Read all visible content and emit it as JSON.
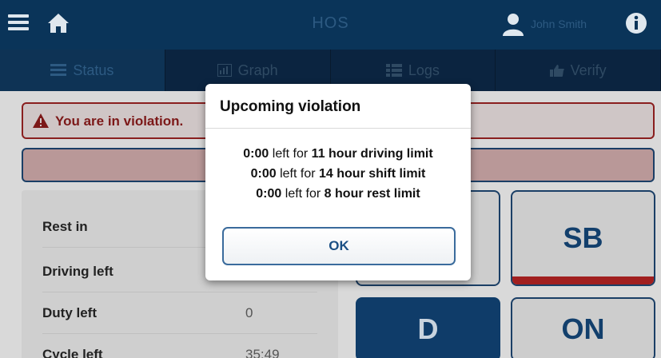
{
  "header": {
    "title": "HOS",
    "user_name": "John Smith"
  },
  "tabs": [
    {
      "label": "Status",
      "icon": "status-list-icon",
      "active": true
    },
    {
      "label": "Graph",
      "icon": "graph-icon",
      "active": false
    },
    {
      "label": "Logs",
      "icon": "logs-icon",
      "active": false
    },
    {
      "label": "Verify",
      "icon": "thumbs-up-icon",
      "active": false
    }
  ],
  "alert": {
    "text": "You are in violation."
  },
  "stats": [
    {
      "label": "Rest in",
      "value": ""
    },
    {
      "label": "Driving left",
      "value": ""
    },
    {
      "label": "Duty left",
      "value": "0"
    },
    {
      "label": "Cycle left",
      "value": "35:49"
    }
  ],
  "status_buttons": {
    "sb": "SB",
    "d": "D",
    "on": "ON"
  },
  "modal": {
    "title": "Upcoming violation",
    "lines": [
      {
        "time": "0:00",
        "mid": " left for ",
        "limit": "11 hour driving limit"
      },
      {
        "time": "0:00",
        "mid": " left for ",
        "limit": "14 hour shift limit"
      },
      {
        "time": "0:00",
        "mid": " left for ",
        "limit": "8 hour rest limit"
      }
    ],
    "ok_label": "OK"
  },
  "colors": {
    "topbar": "#0a3459",
    "tab_bar": "#0b2440",
    "violation_red": "#8a1f1f",
    "accent_blue": "#1a4f84"
  }
}
